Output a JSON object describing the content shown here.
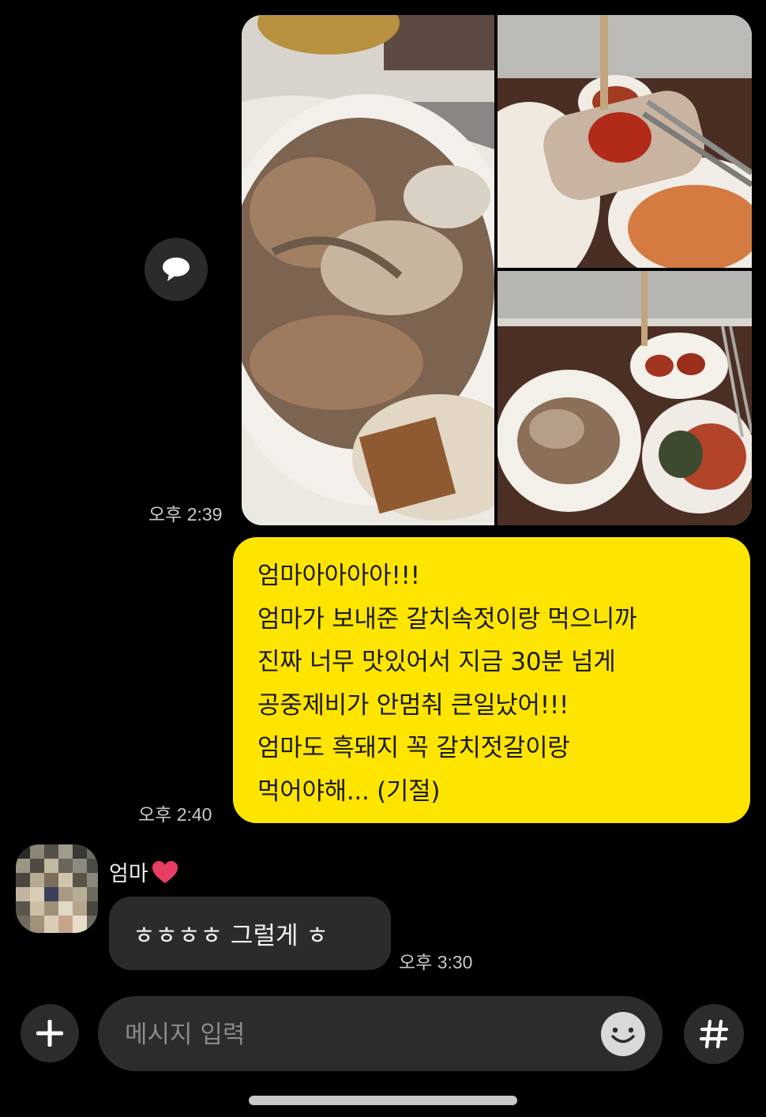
{
  "messages": {
    "photo_time": "오후 2:39",
    "my_lines": [
      "엄마아아아아!!!",
      "엄마가 보내준 갈치속젓이랑 먹으니까",
      "진짜 너무 맛있어서 지금 30분 넘게",
      "공중제비가 안멈춰 큰일났어!!!",
      "엄마도 흑돼지 꼭 갈치젓갈이랑",
      "먹어야해... (기절)"
    ],
    "my_time": "오후 2:40",
    "sender_name": "엄마",
    "reply_text": "ㅎㅎㅎㅎ 그럴게 ㅎ",
    "reply_time": "오후 3:30"
  },
  "input": {
    "placeholder": "메시지 입력",
    "value": ""
  },
  "icons": {
    "share": "speech-bubble-icon",
    "attach": "plus-icon",
    "emoji": "smile-icon",
    "hashtag": "hash-icon",
    "heart": "heart-icon"
  },
  "colors": {
    "my_bubble": "#fee500",
    "their_bubble": "#2b2b2b",
    "background": "#000000",
    "heart": "#e83e63"
  }
}
